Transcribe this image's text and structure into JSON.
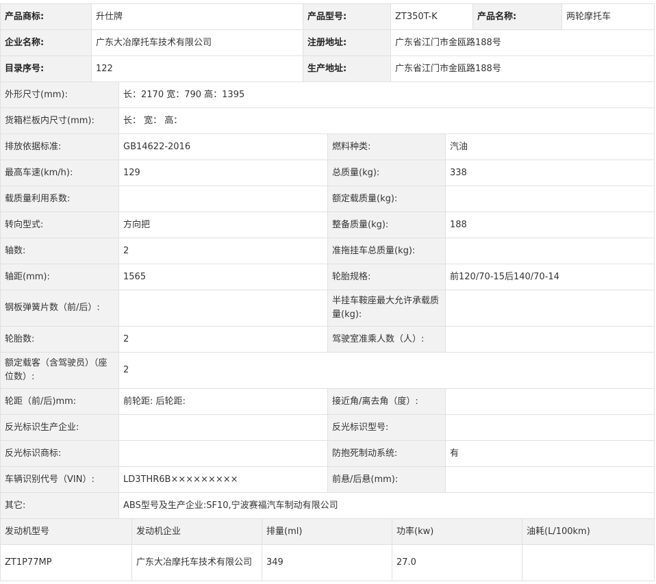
{
  "header": {
    "brand_label": "产品商标:",
    "brand": "升仕牌",
    "model_label": "产品型号:",
    "model": "ZT350T-K",
    "name_label": "产品名称:",
    "name": "两轮摩托车",
    "company_label": "企业名称:",
    "company": "广东大冶摩托车技术有限公司",
    "reg_addr_label": "注册地址:",
    "reg_addr": "广东省江门市金瓯路188号",
    "catalog_label": "目录序号:",
    "catalog": "122",
    "prod_addr_label": "生产地址:",
    "prod_addr": "广东省江门市金瓯路188号"
  },
  "specs": {
    "dims_label": "外形尺寸(mm):",
    "dims": "长：2170 宽：790 高：1395",
    "cargo_label": "货箱栏板内尺寸(mm):",
    "cargo": "长：  宽：  高：",
    "emission_label": "排放依据标准:",
    "emission": "GB14622-2016",
    "fuel_label": "燃料种类:",
    "fuel": "汽油",
    "speed_label": "最高车速(km/h):",
    "speed": "129",
    "total_mass_label": "总质量(kg):",
    "total_mass": "338",
    "load_coef_label": "载质量利用系数:",
    "load_coef": "",
    "rated_load_label": "额定载质量(kg):",
    "rated_load": "",
    "steering_label": "转向型式:",
    "steering": "方向把",
    "curb_mass_label": "整备质量(kg):",
    "curb_mass": "188",
    "axles_label": "轴数:",
    "axles": "2",
    "trailer_label": "准拖挂车总质量(kg):",
    "trailer": "",
    "wheelbase_label": "轴距(mm):",
    "wheelbase": "1565",
    "tire_spec_label": "轮胎规格:",
    "tire_spec": "前120/70-15后140/70-14",
    "springs_label": "钢板弹簧片数（前/后）:",
    "springs": "",
    "saddle_label": "半挂车鞍座最大允许承载质量(kg):",
    "saddle": "",
    "tires_label": "轮胎数:",
    "tires": "2",
    "cab_label": "驾驶室准乘人数（人）:",
    "cab": "",
    "seats_label": "额定载客（含驾驶员）（座位数）:",
    "seats": "2",
    "track_label": "轮距（前/后)mm:",
    "track": "前轮距: 后轮距:",
    "angle_label": "接近角/离去角（度）:",
    "angle": "",
    "reflect_maker_label": "反光标识生产企业:",
    "reflect_maker": "",
    "reflect_model_label": "反光标识型号:",
    "reflect_model": "",
    "reflect_brand_label": "反光标识商标:",
    "reflect_brand": "",
    "abs_label": "防抱死制动系统:",
    "abs": "有",
    "vin_label": "车辆识别代号（VIN）:",
    "vin": "LD3THR6B×××××××××",
    "overhang_label": "前悬/后悬(mm):",
    "overhang": "",
    "other_label": "其它:",
    "other": "ABS型号及生产企业:SF10,宁波赛福汽车制动有限公司"
  },
  "engine": {
    "headers": [
      "发动机型号",
      "发动机企业",
      "排量(ml)",
      "功率(kw)",
      "油耗(L/100km)"
    ],
    "row": [
      "ZT1P77MP",
      "广东大冶摩托车技术有限公司",
      "349",
      "27.0",
      ""
    ]
  }
}
